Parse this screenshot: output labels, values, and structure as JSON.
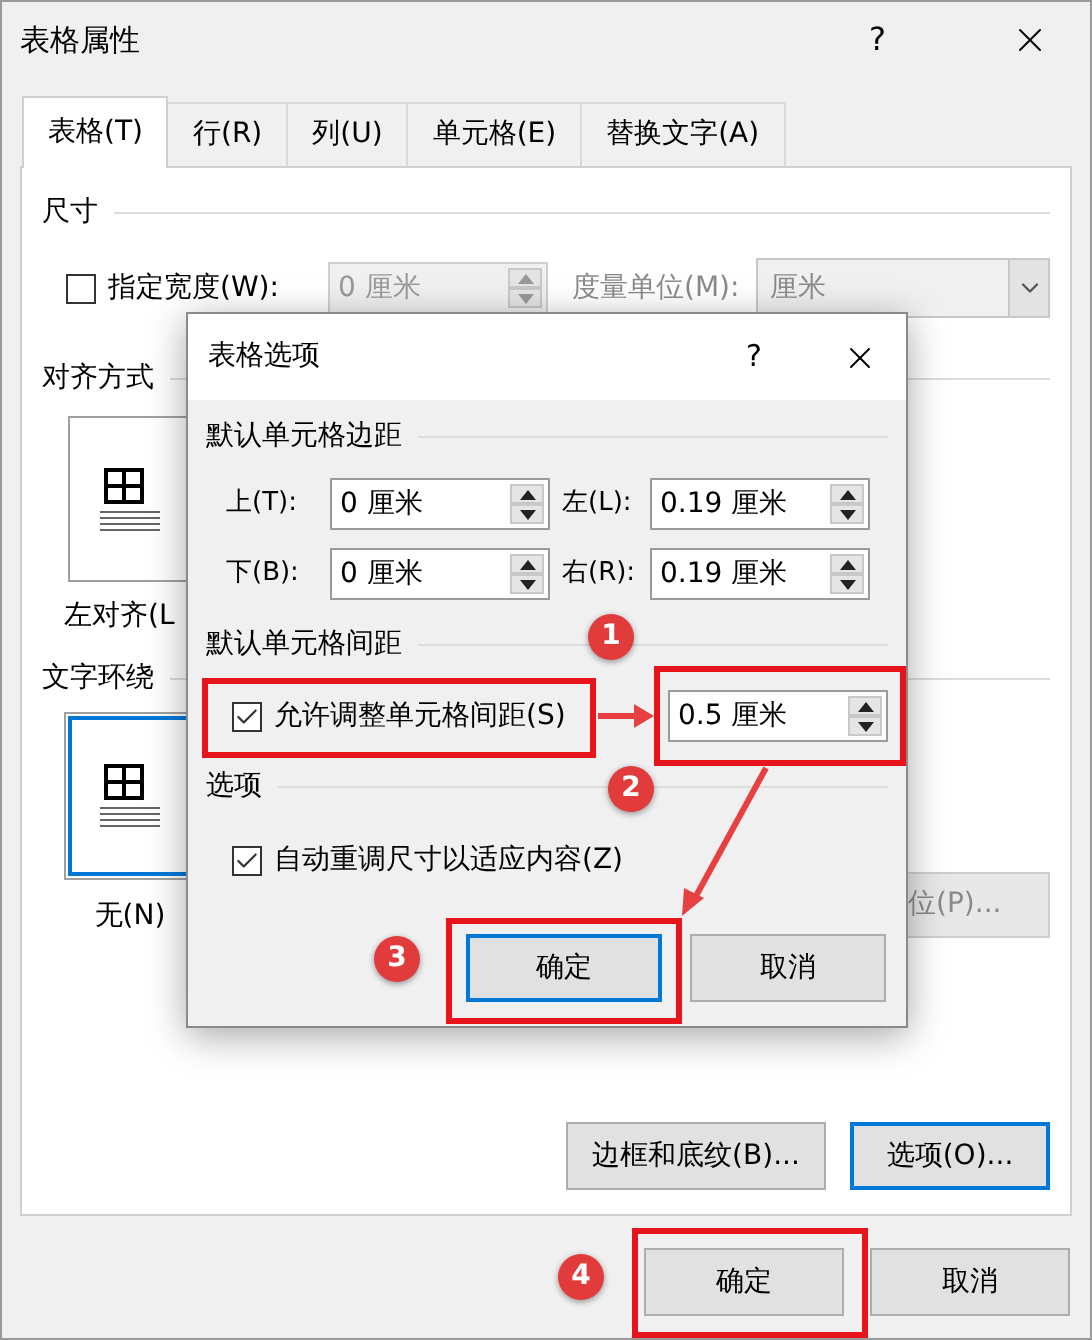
{
  "window": {
    "title": "表格属性",
    "help": "?"
  },
  "tabs": [
    {
      "label": "表格(T)",
      "selected": true
    },
    {
      "label": "行(R)",
      "selected": false
    },
    {
      "label": "列(U)",
      "selected": false
    },
    {
      "label": "单元格(E)",
      "selected": false
    },
    {
      "label": "替换文字(A)",
      "selected": false
    }
  ],
  "size_section": {
    "heading": "尺寸",
    "preferred_width": {
      "label": "指定宽度(W):",
      "checked": false,
      "value": "0 厘米",
      "disabled": true
    },
    "unit": {
      "label": "度量单位(M):",
      "value": "厘米",
      "disabled": true
    }
  },
  "alignment": {
    "heading": "对齐方式",
    "options": [
      {
        "label": "左对齐(L",
        "selected": false
      }
    ]
  },
  "text_wrapping": {
    "heading": "文字环绕",
    "options": [
      {
        "label": "无(N)",
        "selected": true
      }
    ]
  },
  "positioning_button": {
    "label": "位(P)...",
    "disabled": true
  },
  "panel_buttons": [
    {
      "label": "边框和底纹(B)...",
      "focused": false
    },
    {
      "label": "选项(O)...",
      "focused": true
    }
  ],
  "footer_buttons": [
    {
      "label": "确定",
      "focused": false
    },
    {
      "label": "取消",
      "focused": false
    }
  ],
  "options_dialog": {
    "title": "表格选项",
    "help": "?",
    "margins": {
      "heading": "默认单元格边距",
      "fields": [
        {
          "label": "上(T):",
          "value": "0 厘米"
        },
        {
          "label": "左(L):",
          "value": "0.19 厘米"
        },
        {
          "label": "下(B):",
          "value": "0 厘米"
        },
        {
          "label": "右(R):",
          "value": "0.19 厘米"
        }
      ]
    },
    "spacing": {
      "heading": "默认单元格间距",
      "allow": {
        "label": "允许调整单元格间距(S)",
        "checked": true
      },
      "value": "0.5 厘米"
    },
    "options": {
      "heading": "选项",
      "auto_resize": {
        "label": "自动重调尺寸以适应内容(Z)",
        "checked": true
      }
    },
    "buttons": [
      {
        "label": "确定",
        "focused": true
      },
      {
        "label": "取消",
        "focused": false
      }
    ]
  },
  "annotations": [
    {
      "label": "1"
    },
    {
      "label": "2"
    },
    {
      "label": "3"
    },
    {
      "label": "4"
    }
  ]
}
